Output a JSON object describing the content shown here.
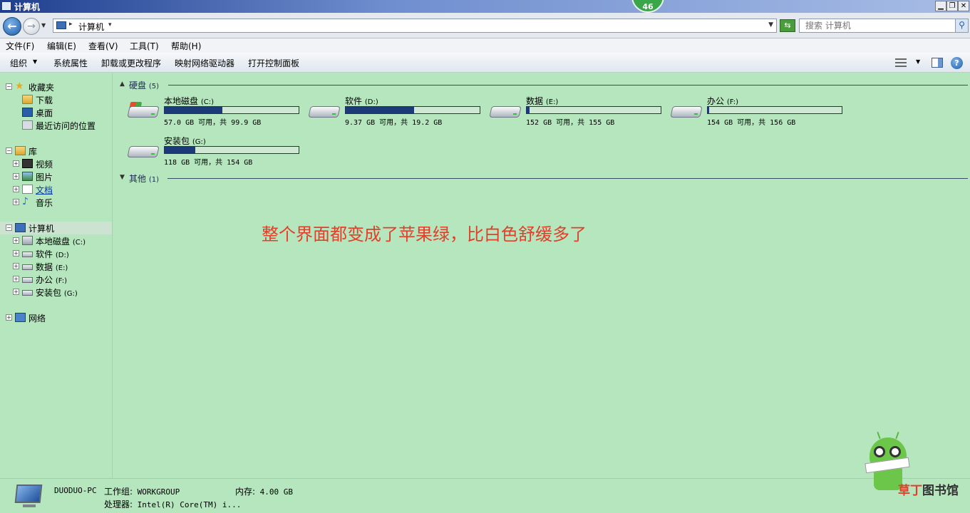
{
  "window": {
    "title": "计算机",
    "badge": "46"
  },
  "address": {
    "crumb": "计算机"
  },
  "search": {
    "placeholder": "搜索 计算机"
  },
  "menu": [
    "文件(F)",
    "编辑(E)",
    "查看(V)",
    "工具(T)",
    "帮助(H)"
  ],
  "toolbar": {
    "organize": "组织",
    "system_properties": "系统属性",
    "uninstall": "卸载或更改程序",
    "map_drive": "映射网络驱动器",
    "control_panel": "打开控制面板"
  },
  "nav": {
    "favorites": "收藏夹",
    "downloads": "下载",
    "desktop": "桌面",
    "recent": "最近访问的位置",
    "libraries": "库",
    "videos": "视频",
    "pictures": "图片",
    "documents": "文档",
    "music": "音乐",
    "computer": "计算机",
    "drives": [
      {
        "name": "本地磁盘",
        "letter": "(C:)"
      },
      {
        "name": "软件",
        "letter": "(D:)"
      },
      {
        "name": "数据",
        "letter": "(E:)"
      },
      {
        "name": "办公",
        "letter": "(F:)"
      },
      {
        "name": "安装包",
        "letter": "(G:)"
      }
    ],
    "network": "网络"
  },
  "groups": {
    "disks": {
      "label": "硬盘",
      "count": "(5)"
    },
    "other": {
      "label": "其他",
      "count": "(1)"
    }
  },
  "drives": [
    {
      "name": "本地磁盘",
      "letter": "(C:)",
      "free": "57.0 GB 可用，共 99.9 GB",
      "used_fraction": 0.43,
      "system": true
    },
    {
      "name": "软件",
      "letter": "(D:)",
      "free": "9.37 GB 可用，共 19.2 GB",
      "used_fraction": 0.51,
      "system": false
    },
    {
      "name": "数据",
      "letter": "(E:)",
      "free": "152 GB 可用，共 155 GB",
      "used_fraction": 0.02,
      "system": false
    },
    {
      "name": "办公",
      "letter": "(F:)",
      "free": "154 GB 可用，共 156 GB",
      "used_fraction": 0.01,
      "system": false
    },
    {
      "name": "安装包",
      "letter": "(G:)",
      "free": "118 GB 可用，共 154 GB",
      "used_fraction": 0.23,
      "system": false
    }
  ],
  "annotation": "整个界面都变成了苹果绿，比白色舒缓多了",
  "details": {
    "pc_name": "DUODUO-PC",
    "workgroup_label": "工作组:",
    "workgroup": "WORKGROUP",
    "memory_label": "内存:",
    "memory": "4.00 GB",
    "processor_label": "处理器:",
    "processor": "Intel(R) Core(TM) i..."
  },
  "watermark": {
    "accent": "草丁",
    "rest": "图书馆"
  },
  "colors": {
    "background": "#b5e6be",
    "annotation": "#e0402a",
    "bar_fill": "#1d3a78"
  }
}
